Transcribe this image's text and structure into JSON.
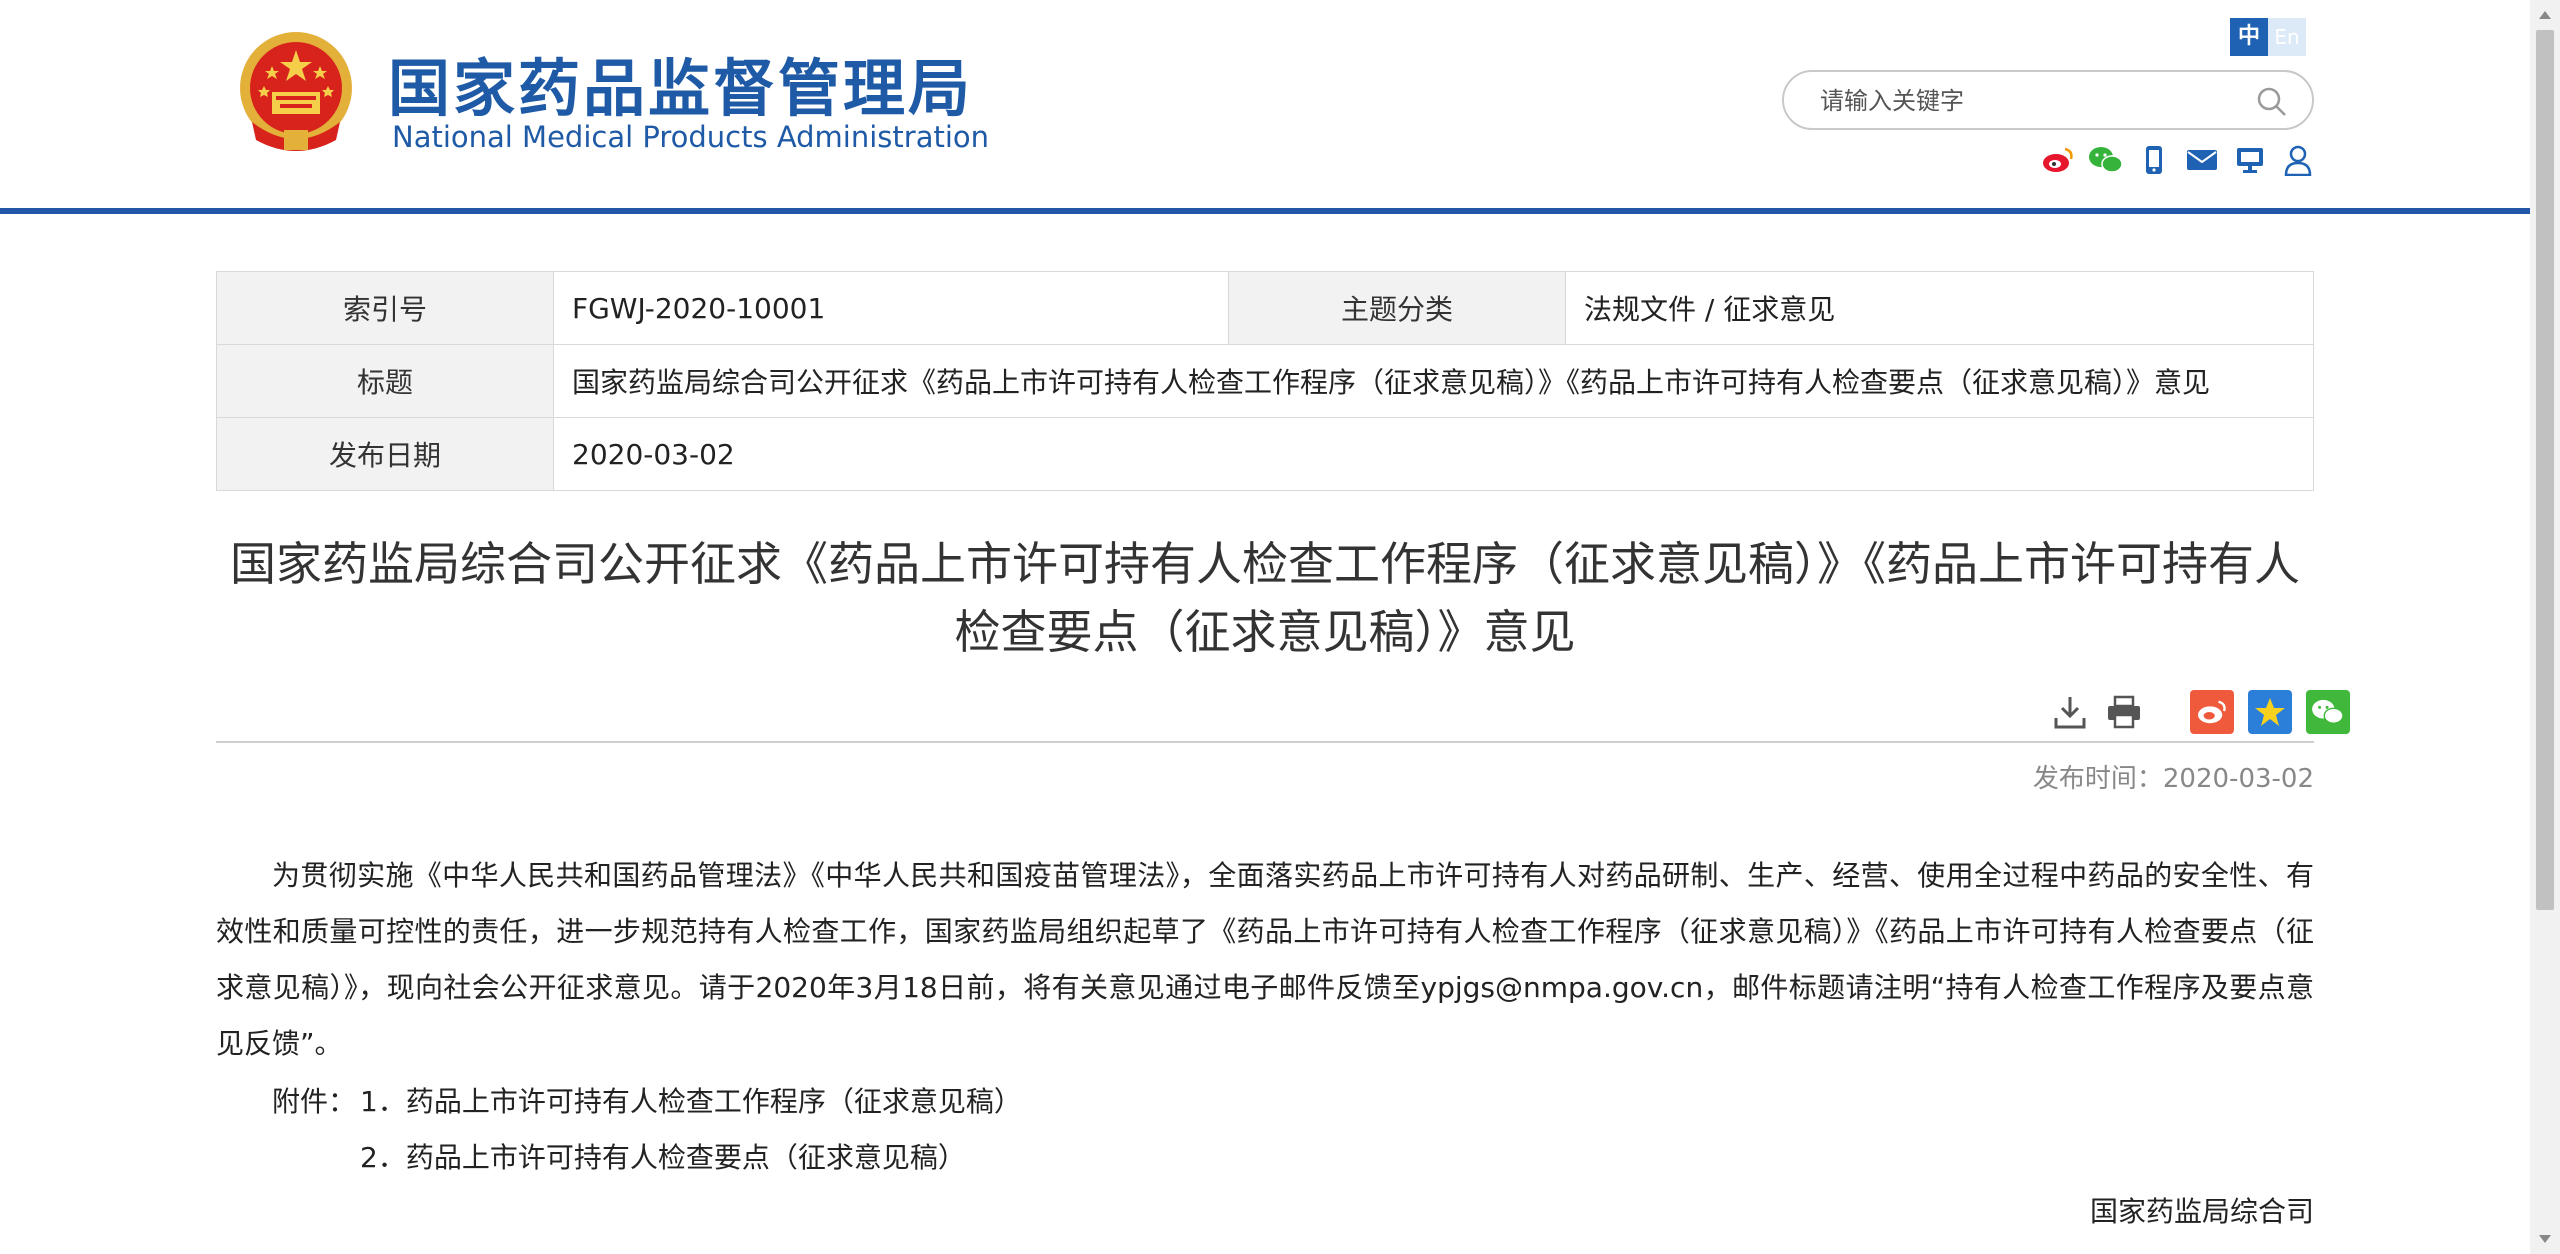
{
  "header": {
    "title_cn": "国家药品监督管理局",
    "title_en": "National Medical Products Administration",
    "lang_zh": "中",
    "lang_en": "En",
    "search_placeholder": "请输入关键字",
    "social_icons": [
      "weibo-icon",
      "wechat-icon",
      "mobile-icon",
      "mail-icon",
      "screen-icon",
      "user-icon"
    ],
    "accent_color": "#2156a8"
  },
  "info": {
    "index_label": "索引号",
    "index_value": "FGWJ-2020-10001",
    "category_label": "主题分类",
    "category_value": "法规文件 / 征求意见",
    "title_label": "标题",
    "title_value": "国家药监局综合司公开征求《药品上市许可持有人检查工作程序（征求意见稿）》《药品上市许可持有人检查要点（征求意见稿）》意见",
    "date_label": "发布日期",
    "date_value": "2020-03-02"
  },
  "article": {
    "title": "国家药监局综合司公开征求《药品上市许可持有人检查工作程序（征求意见稿）》《药品上市许可持有人检查要点（征求意见稿）》意见",
    "publish_time": "发布时间：2020-03-02",
    "body": "为贯彻实施《中华人民共和国药品管理法》《中华人民共和国疫苗管理法》，全面落实药品上市许可持有人对药品研制、生产、经营、使用全过程中药品的安全性、有效性和质量可控性的责任，进一步规范持有人检查工作，国家药监局组织起草了《药品上市许可持有人检查工作程序（征求意见稿）》《药品上市许可持有人检查要点（征求意见稿）》，现向社会公开征求意见。请于2020年3月18日前，将有关意见通过电子邮件反馈至ypjgs@nmpa.gov.cn，邮件标题请注明“持有人检查工作程序及要点意见反馈”。",
    "attachment_label": "附件：",
    "attachment_1": "1．药品上市许可持有人检查工作程序（征求意见稿）",
    "attachment_2": "2．药品上市许可持有人检查要点（征求意见稿）",
    "signature": "国家药监局综合司",
    "tools": [
      "download-icon",
      "print-icon"
    ],
    "share": [
      "weibo-share-icon",
      "favorite-share-icon",
      "wechat-share-icon"
    ]
  }
}
